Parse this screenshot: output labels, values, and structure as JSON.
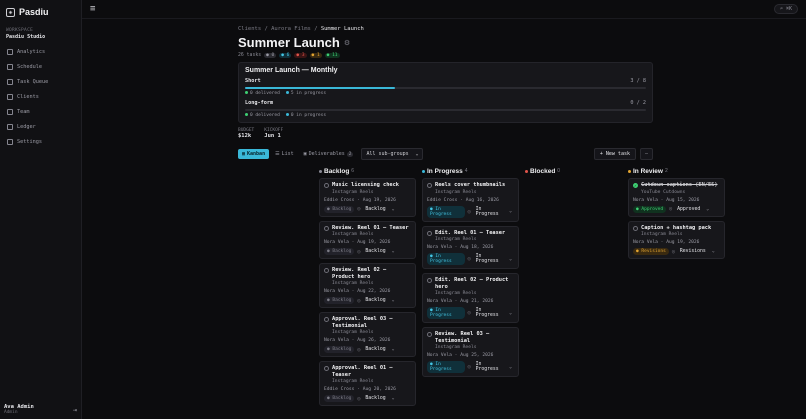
{
  "sidebar": {
    "brand": "Pasdiu",
    "workspace_label": "WORKSPACE",
    "workspace_name": "Pasdiu Studio",
    "items": [
      {
        "label": "Analytics",
        "icon": "chart-icon"
      },
      {
        "label": "Schedule",
        "icon": "calendar-icon"
      },
      {
        "label": "Task Queue",
        "icon": "inbox-icon"
      },
      {
        "label": "Clients",
        "icon": "building-icon"
      },
      {
        "label": "Team",
        "icon": "users-icon"
      },
      {
        "label": "Ledger",
        "icon": "ledger-icon"
      },
      {
        "label": "Settings",
        "icon": "gear-icon"
      }
    ],
    "user_name": "Ava Admin",
    "user_role": "Admin"
  },
  "topbar": {
    "search_shortcut": "⌘K"
  },
  "breadcrumb": {
    "a": "Clients",
    "b": "Aurora Films",
    "c": "Summer Launch",
    "sep": "/"
  },
  "page": {
    "title": "Summer Launch",
    "tasks_count": "26 tasks",
    "chips": [
      "0",
      "6",
      "3",
      "1",
      "11"
    ]
  },
  "progress": {
    "title": "Summer Launch — Monthly",
    "rows": [
      {
        "name": "Short",
        "count": "3 / 8",
        "fraction": 0.375,
        "delivered": "0 delivered",
        "in_progress": "5 in progress"
      },
      {
        "name": "Long-form",
        "count": "0 / 2",
        "fraction": 0,
        "delivered": "0 delivered",
        "in_progress": "0 in progress"
      }
    ]
  },
  "budget": {
    "budget_label": "BUDGET",
    "budget_value": "$12k",
    "kickoff_label": "KICKOFF",
    "kickoff_value": "Jun 1"
  },
  "toolbar": {
    "tabs": [
      {
        "label": "Kanban",
        "active": true
      },
      {
        "label": "List",
        "active": false
      },
      {
        "label": "Deliverables",
        "active": false,
        "badge": "2"
      }
    ],
    "filter": "All sub-groups",
    "new_task": "+ New task",
    "more": "—"
  },
  "columns": [
    {
      "name": "Backlog",
      "count": "6",
      "color": "#8a8a94",
      "cards": [
        {
          "title": "Music licensing check",
          "sub": "Instagram Reels",
          "who": "Eddie Cross · Aug 19, 2026",
          "status": "Backlog",
          "kind": "backlog",
          "select": "Backlog"
        },
        {
          "title": "Review. Reel 01 — Teaser",
          "sub": "Instagram Reels",
          "who": "Nora Vela · Aug 19, 2026",
          "status": "Backlog",
          "kind": "backlog",
          "select": "Backlog"
        },
        {
          "title": "Review. Reel 02 — Product hero",
          "sub": "Instagram Reels",
          "who": "Nora Vela · Aug 22, 2026",
          "status": "Backlog",
          "kind": "backlog",
          "select": "Backlog"
        },
        {
          "title": "Approval. Reel 03 — Testimonial",
          "sub": "Instagram Reels",
          "who": "Nora Vela · Aug 26, 2026",
          "status": "Backlog",
          "kind": "backlog",
          "select": "Backlog"
        },
        {
          "title": "Approval. Reel 01 — Teaser",
          "sub": "Instagram Reels",
          "who": "Eddie Cross · Aug 20, 2026",
          "status": "Backlog",
          "kind": "backlog",
          "select": "Backlog"
        }
      ]
    },
    {
      "name": "In Progress",
      "count": "4",
      "color": "#3ab8d8",
      "cards": [
        {
          "title": "Reels cover thumbnails",
          "sub": "Instagram Reels",
          "who": "Eddie Cross · Aug 16, 2026",
          "status": "In Progress",
          "kind": "progress",
          "select": "In Progress"
        },
        {
          "title": "Edit. Reel 01 — Teaser",
          "sub": "Instagram Reels",
          "who": "Nora Vela · Aug 18, 2026",
          "status": "In Progress",
          "kind": "progress",
          "select": "In Progress"
        },
        {
          "title": "Edit. Reel 02 — Product hero",
          "sub": "Instagram Reels",
          "who": "Nora Vela · Aug 21, 2026",
          "status": "In Progress",
          "kind": "progress",
          "select": "In Progress"
        },
        {
          "title": "Review. Reel 03 — Testimonial",
          "sub": "Instagram Reels",
          "who": "Nora Vela · Aug 25, 2026",
          "status": "In Progress",
          "kind": "progress",
          "select": "In Progress"
        }
      ]
    },
    {
      "name": "Blocked",
      "count": "0",
      "color": "#e0544a",
      "cards": []
    },
    {
      "name": "In Review",
      "count": "2",
      "color": "#e3a531",
      "cards": [
        {
          "title": "Cutdown captions (EN/ES)",
          "sub": "YouTube Cutdowns",
          "who": "Nora Vela · Aug 15, 2026",
          "status": "Approved",
          "kind": "approved",
          "select": "Approved",
          "done": true
        },
        {
          "title": "Caption + hashtag pack",
          "sub": "Instagram Reels",
          "who": "Nora Vela · Aug 19, 2026",
          "status": "Revisions",
          "kind": "revisions",
          "select": "Revisions"
        }
      ]
    }
  ]
}
